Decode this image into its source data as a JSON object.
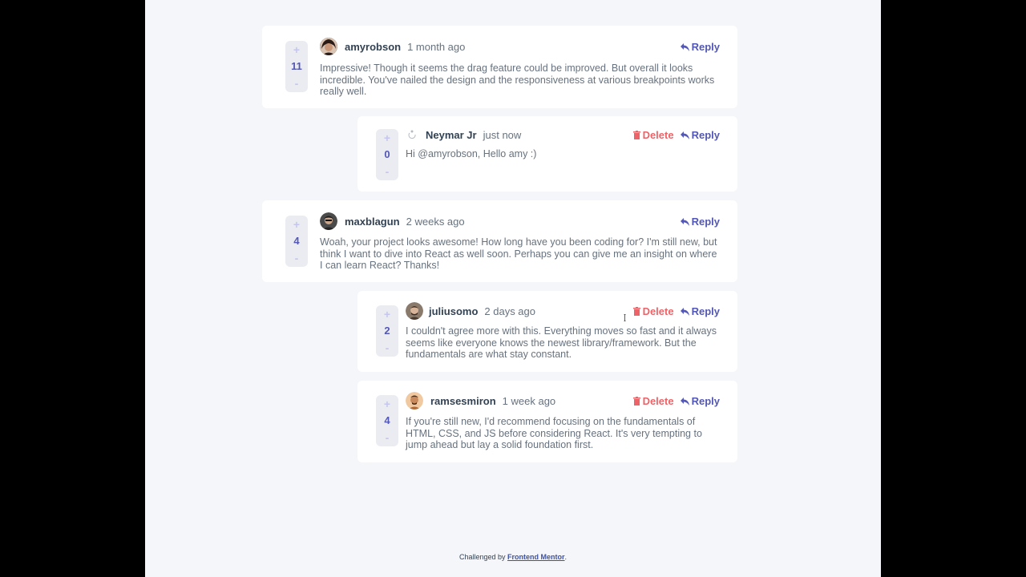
{
  "comments": [
    {
      "score": "11",
      "username": "amyrobson",
      "time": "1 month ago",
      "reply_label": "Reply",
      "text": "Impressive! Though it seems the drag feature could be improved. But overall it looks incredible. You've nailed the design and the responsiveness at various breakpoints works really well."
    },
    {
      "score": "0",
      "username": "Neymar Jr",
      "time": "just now",
      "delete_label": "Delete",
      "reply_label": "Reply",
      "text": "Hi @amyrobson, Hello amy :)"
    },
    {
      "score": "4",
      "username": "maxblagun",
      "time": "2 weeks ago",
      "reply_label": "Reply",
      "text": "Woah, your project looks awesome! How long have you been coding for? I'm still new, but think I want to dive into React as well soon. Perhaps you can give me an insight on where I can learn React? Thanks!"
    },
    {
      "score": "2",
      "username": "juliusomo",
      "time": "2 days ago",
      "delete_label": "Delete",
      "reply_label": "Reply",
      "text": "I couldn't agree more with this. Everything moves so fast and it always seems like everyone knows the newest library/framework. But the fundamentals are what stay constant."
    },
    {
      "score": "4",
      "username": "ramsesmiron",
      "time": "1 week ago",
      "delete_label": "Delete",
      "reply_label": "Reply",
      "text": "If you're still new, I'd recommend focusing on the fundamentals of HTML, CSS, and JS before considering React. It's very tempting to jump ahead but lay a solid foundation first."
    }
  ],
  "vote": {
    "plus": "+",
    "minus": "-"
  },
  "footer": {
    "prefix": "Challenged by",
    "link": "Frontend Mentor",
    "suffix": "."
  },
  "colors": {
    "accent": "#5357b6",
    "danger": "#ed6368",
    "page_bg": "#f5f6fa",
    "card_bg": "#ffffff",
    "muted_text": "#67727e",
    "heading_text": "#334253"
  },
  "icons": {
    "reply": "reply-arrow-icon",
    "delete": "trash-icon"
  }
}
